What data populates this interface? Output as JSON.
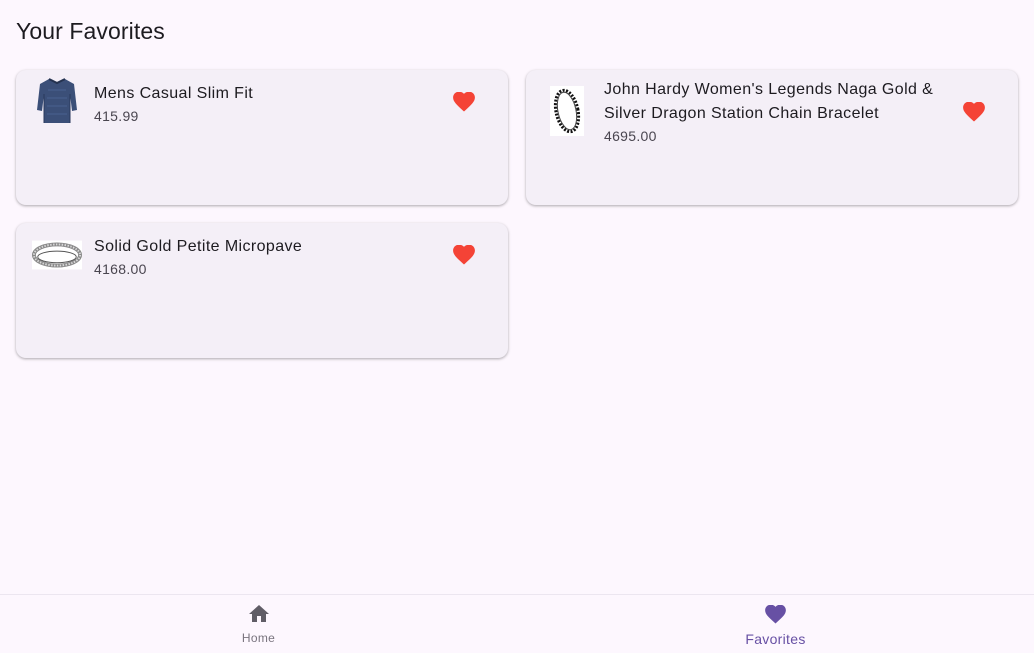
{
  "page": {
    "title": "Your Favorites"
  },
  "favorites": [
    {
      "name": "Mens Casual Slim Fit",
      "price": "415.99",
      "icon": "heart-icon"
    },
    {
      "name": "John Hardy Women's Legends Naga Gold & Silver Dragon Station Chain Bracelet",
      "price": "4695.00",
      "icon": "heart-icon"
    },
    {
      "name": "Solid Gold Petite Micropave",
      "price": "4168.00",
      "icon": "heart-icon"
    }
  ],
  "bottom_nav": {
    "items": [
      {
        "label": "Home",
        "icon": "home-icon",
        "active": false
      },
      {
        "label": "Favorites",
        "icon": "heart-icon",
        "active": true
      }
    ]
  },
  "colors": {
    "background": "#fdf7fe",
    "card": "#f4eff7",
    "favorite_heart": "#f44336",
    "accent": "#6750a4",
    "inactive": "#79747e"
  }
}
